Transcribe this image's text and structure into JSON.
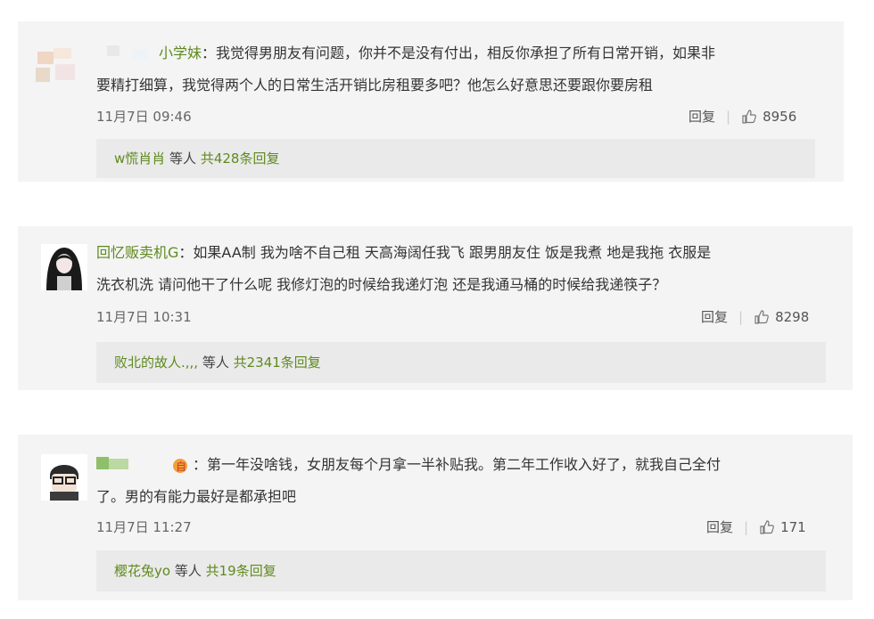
{
  "comments": [
    {
      "username": "小学妹",
      "separator": "：",
      "line1": "我觉得男朋友有问题，你并不是没有付出，相反你承担了所有日常开销，如果非",
      "line2": "要精打细算，我觉得两个人的日常生活开销比房租要多吧？他怎么好意思还要跟你要房租",
      "time": "11月7日 09:46",
      "reply_label": "回复",
      "likes": "8956",
      "reply_user": "w慌肖肖",
      "reply_mid": " 等人 ",
      "reply_count": "共428条回复"
    },
    {
      "username": "回忆贩卖机G",
      "separator": "：",
      "line1": "如果AA制 我为啥不自己租 天高海阔任我飞 跟男朋友住 饭是我煮 地是我拖 衣服是",
      "line2": "洗衣机洗 请问他干了什么呢 我修灯泡的时候给我递灯泡 还是我通马桶的时候给我递筷子？",
      "time": "11月7日 10:31",
      "reply_label": "回复",
      "likes": "8298",
      "reply_user": "败北的故人.,,,",
      "reply_mid": " 等人 ",
      "reply_count": "共2341条回复"
    },
    {
      "username": "",
      "separator": "：",
      "line1": "第一年没啥钱，女朋友每个月拿一半补贴我。第二年工作收入好了，就我自己全付",
      "line2": "了。男的有能力最好是都承担吧",
      "time": "11月7日 11:27",
      "reply_label": "回复",
      "likes": "171",
      "reply_user": "樱花兔yo",
      "reply_mid": " 等人 ",
      "reply_count": "共19条回复"
    }
  ],
  "colors": {
    "username": "#5f8a1f",
    "card_bg": "#f4f4f4",
    "reply_bg": "#eaeaea"
  },
  "icons": [
    "blurred-avatar",
    "girl-avatar",
    "boy-glasses-avatar",
    "thumbs-up-icon",
    "vip-badge-icon"
  ]
}
